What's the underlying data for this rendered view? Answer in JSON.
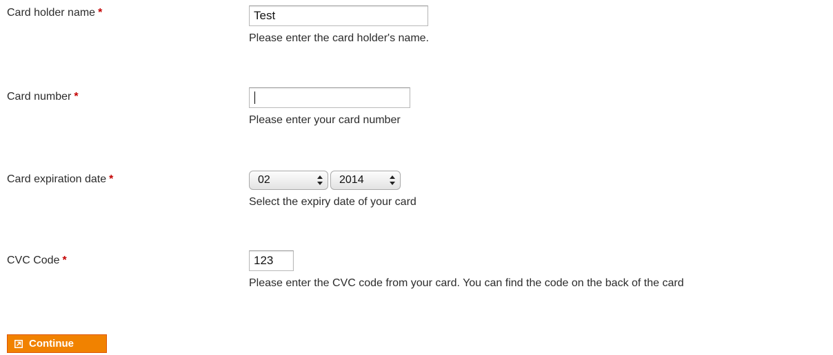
{
  "colors": {
    "required_marker": "#c40000",
    "button_bg": "#f18200",
    "button_border": "#de5400"
  },
  "form": {
    "card_holder": {
      "label": "Card holder name",
      "required_mark": "*",
      "value": "Test",
      "hint": "Please enter the card holder's name."
    },
    "card_number": {
      "label": "Card number",
      "required_mark": "*",
      "value": "",
      "hint": "Please enter your card number"
    },
    "expiration": {
      "label": "Card expiration date",
      "required_mark": "*",
      "month_selected": "02",
      "year_selected": "2014",
      "hint": "Select the expiry date of your card"
    },
    "cvc": {
      "label": "CVC Code",
      "required_mark": "*",
      "value": "123",
      "hint": "Please enter the CVC code from your card. You can find the code on the back of the card"
    }
  },
  "actions": {
    "continue_label": "Continue",
    "continue_icon": "continue-arrow-icon"
  }
}
